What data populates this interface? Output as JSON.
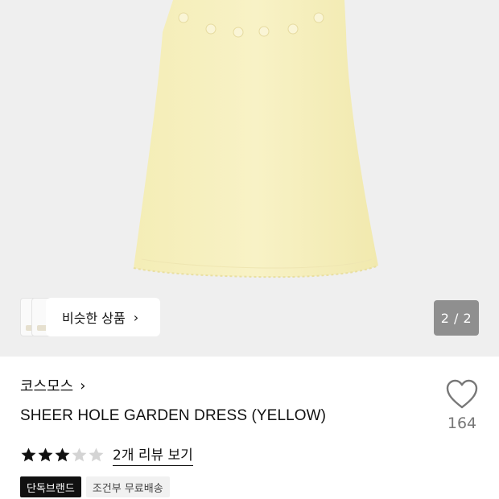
{
  "gallery": {
    "similar_label": "비슷한 상품",
    "similar_chevron": "›",
    "page_indicator": "2 / 2"
  },
  "product": {
    "brand": "코스모스",
    "brand_chevron": "›",
    "title": "SHEER HOLE GARDEN DRESS (YELLOW)",
    "like_count": "164",
    "rating": 3,
    "rating_max": 5,
    "review_link": "2개 리뷰 보기",
    "tags": [
      "단독브랜드",
      "조건부 무료배송"
    ]
  },
  "colors": {
    "dress": "#f6f0bf",
    "star_filled": "#111111",
    "star_empty": "#d4d4d4"
  }
}
